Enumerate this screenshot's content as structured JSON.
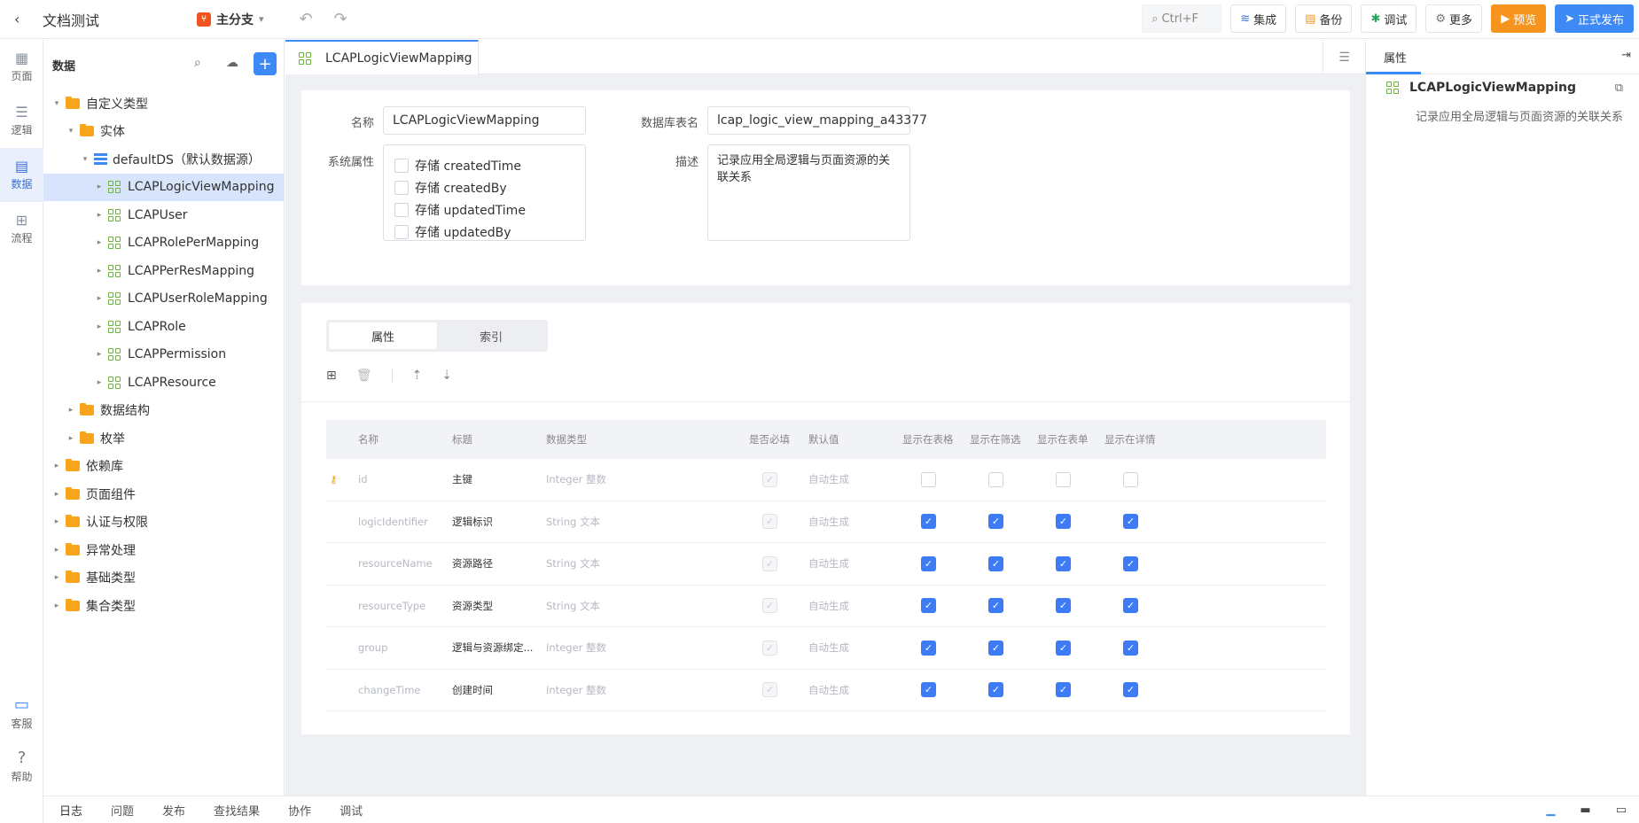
{
  "topbar": {
    "title": "文档测试",
    "branch": "主分支",
    "search": "Ctrl+F",
    "buttons": [
      "集成",
      "备份",
      "调试",
      "更多"
    ],
    "preview": "预览",
    "publish": "正式发布"
  },
  "rail": {
    "items": [
      "页面",
      "逻辑",
      "数据",
      "流程"
    ],
    "bottom": [
      "客服",
      "帮助"
    ]
  },
  "tree": {
    "title": "数据",
    "nodes": [
      {
        "label": "自定义类型",
        "level": 0,
        "type": "folder",
        "arrow": "▾"
      },
      {
        "label": "实体",
        "level": 1,
        "type": "folder",
        "arrow": "▾"
      },
      {
        "label": "defaultDS（默认数据源）",
        "level": 2,
        "type": "db",
        "arrow": "▾"
      },
      {
        "label": "LCAPLogicViewMapping",
        "level": 3,
        "type": "entity",
        "arrow": "▸",
        "selected": true
      },
      {
        "label": "LCAPUser",
        "level": 3,
        "type": "entity",
        "arrow": "▸"
      },
      {
        "label": "LCAPRolePerMapping",
        "level": 3,
        "type": "entity",
        "arrow": "▸"
      },
      {
        "label": "LCAPPerResMapping",
        "level": 3,
        "type": "entity",
        "arrow": "▸"
      },
      {
        "label": "LCAPUserRoleMapping",
        "level": 3,
        "type": "entity",
        "arrow": "▸"
      },
      {
        "label": "LCAPRole",
        "level": 3,
        "type": "entity",
        "arrow": "▸"
      },
      {
        "label": "LCAPPermission",
        "level": 3,
        "type": "entity",
        "arrow": "▸"
      },
      {
        "label": "LCAPResource",
        "level": 3,
        "type": "entity",
        "arrow": "▸"
      },
      {
        "label": "数据结构",
        "level": 1,
        "type": "folder",
        "arrow": "▸"
      },
      {
        "label": "枚举",
        "level": 1,
        "type": "folder",
        "arrow": "▸"
      },
      {
        "label": "依赖库",
        "level": 0,
        "type": "folder",
        "arrow": "▸"
      },
      {
        "label": "页面组件",
        "level": 0,
        "type": "folder",
        "arrow": "▸"
      },
      {
        "label": "认证与权限",
        "level": 0,
        "type": "folder",
        "arrow": "▸"
      },
      {
        "label": "异常处理",
        "level": 0,
        "type": "folder",
        "arrow": "▸"
      },
      {
        "label": "基础类型",
        "level": 0,
        "type": "folder",
        "arrow": "▸"
      },
      {
        "label": "集合类型",
        "level": 0,
        "type": "folder",
        "arrow": "▸"
      }
    ]
  },
  "tab": {
    "label": "LCAPLogicViewMapping",
    "close": "×"
  },
  "form": {
    "name_label": "名称",
    "name_value": "LCAPLogicViewMapping",
    "table_label": "数据库表名",
    "table_value": "lcap_logic_view_mapping_a43377",
    "sys_label": "系统属性",
    "sys_options": [
      "存储 createdTime",
      "存储 createdBy",
      "存储 updatedTime",
      "存储 updatedBy"
    ],
    "desc_label": "描述",
    "desc_value": "记录应用全局逻辑与页面资源的关联关系"
  },
  "segment": {
    "attr": "属性",
    "index": "索引"
  },
  "table": {
    "headers": [
      "名称",
      "标题",
      "数据类型",
      "是否必填",
      "默认值",
      "显示在表格",
      "显示在筛选",
      "显示在表单",
      "显示在详情"
    ],
    "rows": [
      {
        "name": "id",
        "title": "主键",
        "type": "Integer 整数",
        "default": "自动生成",
        "key": true,
        "show": [
          false,
          false,
          false,
          false
        ]
      },
      {
        "name": "logicIdentifier",
        "title": "逻辑标识",
        "type": "String 文本",
        "default": "自动生成",
        "key": false,
        "show": [
          true,
          true,
          true,
          true
        ]
      },
      {
        "name": "resourceName",
        "title": "资源路径",
        "type": "String 文本",
        "default": "自动生成",
        "key": false,
        "show": [
          true,
          true,
          true,
          true
        ]
      },
      {
        "name": "resourceType",
        "title": "资源类型",
        "type": "String 文本",
        "default": "自动生成",
        "key": false,
        "show": [
          true,
          true,
          true,
          true
        ]
      },
      {
        "name": "group",
        "title": "逻辑与资源绑定...",
        "type": "Integer 整数",
        "default": "自动生成",
        "key": false,
        "show": [
          true,
          true,
          true,
          true
        ]
      },
      {
        "name": "changeTime",
        "title": "创建时间",
        "type": "Integer 整数",
        "default": "自动生成",
        "key": false,
        "show": [
          true,
          true,
          true,
          true
        ]
      }
    ]
  },
  "right": {
    "tab": "属性",
    "entity_name": "LCAPLogicViewMapping",
    "desc": "记录应用全局逻辑与页面资源的关联关系"
  },
  "bottom": {
    "tabs": [
      "日志",
      "问题",
      "发布",
      "查找结果",
      "协作",
      "调试"
    ]
  }
}
